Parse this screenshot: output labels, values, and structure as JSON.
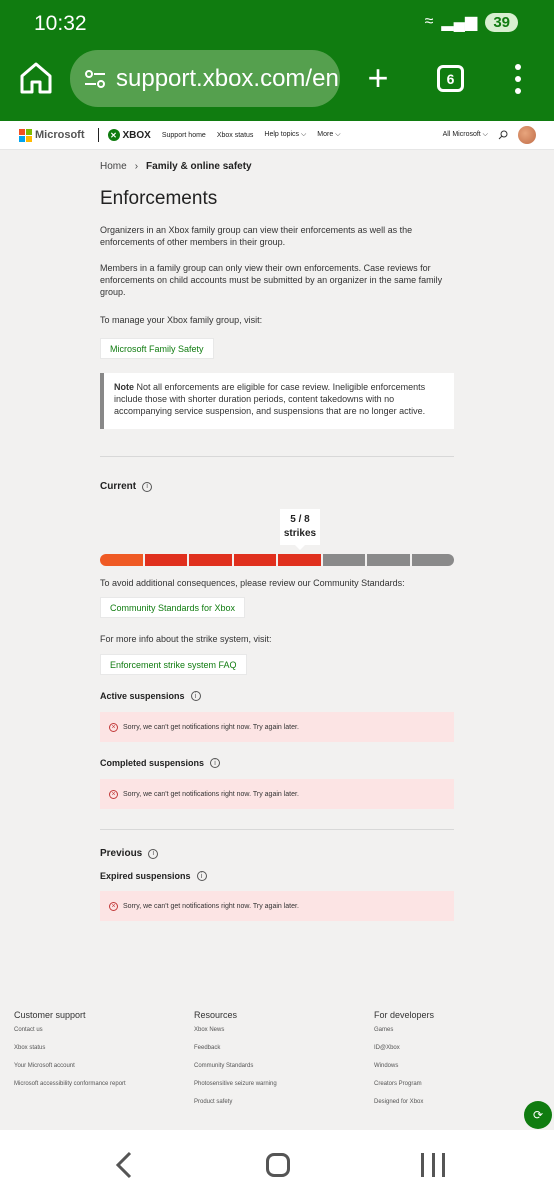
{
  "status_bar": {
    "time": "10:32",
    "battery": "39"
  },
  "browser": {
    "url": "support.xbox.com/en",
    "tab_count": "6",
    "plus": "+"
  },
  "header": {
    "ms_name": "Microsoft",
    "xbox_name": "XBOX",
    "links": [
      "Support home",
      "Xbox status",
      "Help topics ⌵",
      "More ⌵"
    ],
    "all_microsoft": "All Microsoft ⌵"
  },
  "breadcrumb": {
    "home": "Home",
    "current": "Family & online safety"
  },
  "page": {
    "title": "Enforcements",
    "para1": "Organizers in an Xbox family group can view their enforcements as well as the enforcements of other members in their group.",
    "para2": "Members in a family group can only view their own enforcements. Case reviews for enforcements on child accounts must be submitted by an organizer in the same family group.",
    "para3": "To manage your Xbox family group, visit:",
    "family_safety_link": "Microsoft Family Safety",
    "note_label": "Note",
    "note_text": " Not all enforcements are eligible for case review. Ineligible enforcements include those with shorter duration periods, content takedowns with no accompanying service suspension, and suspensions that are no longer active."
  },
  "current": {
    "heading": "Current",
    "strike_count": "5 / 8",
    "strike_unit": "strikes",
    "strikes_filled": 5,
    "strikes_total": 8,
    "colors": {
      "filled_start": "#ef5a24",
      "filled_end": "#e0301e",
      "empty": "#8a8a8a"
    },
    "avoid_text": "To avoid additional consequences, please review our Community Standards:",
    "community_link": "Community Standards for Xbox",
    "more_info_text": "For more info about the strike system, visit:",
    "faq_link": "Enforcement strike system FAQ",
    "active_suspensions": "Active suspensions",
    "active_error": "Sorry, we can't get notifications right now. Try again later.",
    "completed_suspensions": "Completed suspensions",
    "completed_error": "Sorry, we can't get notifications right now. Try again later."
  },
  "previous": {
    "heading": "Previous",
    "expired_suspensions": "Expired suspensions",
    "expired_error": "Sorry, we can't get notifications right now. Try again later."
  },
  "footer": {
    "columns": [
      {
        "title": "Customer support",
        "links": [
          "Contact us",
          "Xbox status",
          "Your Microsoft account",
          "Microsoft accessibility conformance report"
        ]
      },
      {
        "title": "Resources",
        "links": [
          "Xbox News",
          "Feedback",
          "Community Standards",
          "Photosensitive seizure warning",
          "Product safety"
        ]
      },
      {
        "title": "For developers",
        "links": [
          "Games",
          "ID@Xbox",
          "Windows",
          "Creators Program",
          "Designed for Xbox"
        ]
      }
    ]
  }
}
